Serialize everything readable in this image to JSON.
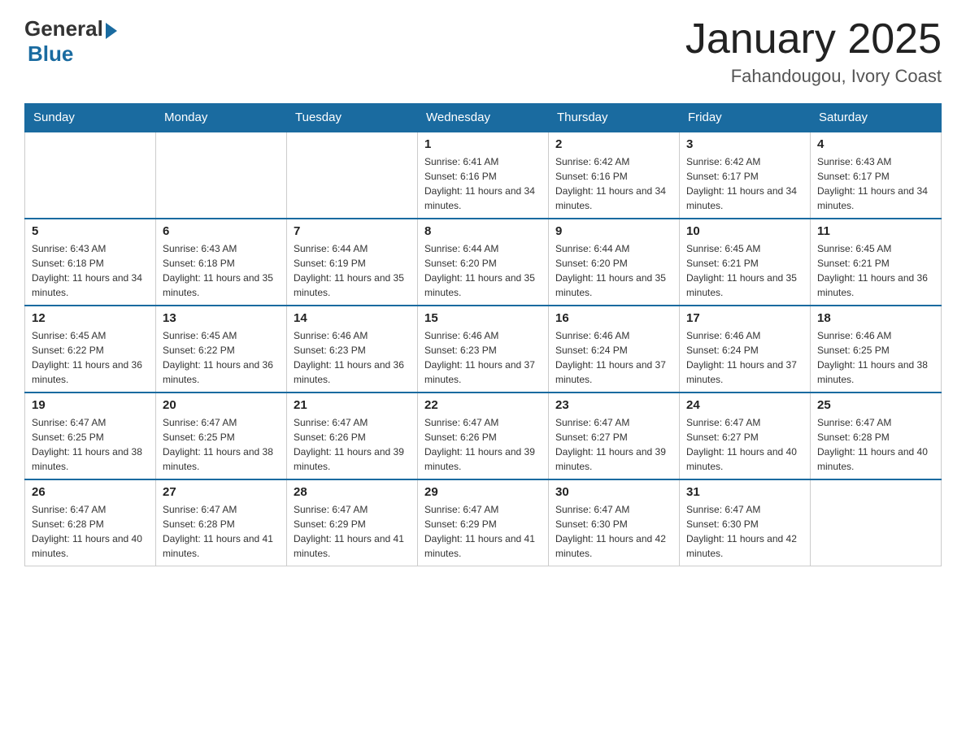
{
  "header": {
    "logo_general": "General",
    "logo_blue": "Blue",
    "month_title": "January 2025",
    "location": "Fahandougou, Ivory Coast"
  },
  "days_of_week": [
    "Sunday",
    "Monday",
    "Tuesday",
    "Wednesday",
    "Thursday",
    "Friday",
    "Saturday"
  ],
  "weeks": [
    {
      "days": [
        {
          "number": "",
          "sunrise": "",
          "sunset": "",
          "daylight": ""
        },
        {
          "number": "",
          "sunrise": "",
          "sunset": "",
          "daylight": ""
        },
        {
          "number": "",
          "sunrise": "",
          "sunset": "",
          "daylight": ""
        },
        {
          "number": "1",
          "sunrise": "Sunrise: 6:41 AM",
          "sunset": "Sunset: 6:16 PM",
          "daylight": "Daylight: 11 hours and 34 minutes."
        },
        {
          "number": "2",
          "sunrise": "Sunrise: 6:42 AM",
          "sunset": "Sunset: 6:16 PM",
          "daylight": "Daylight: 11 hours and 34 minutes."
        },
        {
          "number": "3",
          "sunrise": "Sunrise: 6:42 AM",
          "sunset": "Sunset: 6:17 PM",
          "daylight": "Daylight: 11 hours and 34 minutes."
        },
        {
          "number": "4",
          "sunrise": "Sunrise: 6:43 AM",
          "sunset": "Sunset: 6:17 PM",
          "daylight": "Daylight: 11 hours and 34 minutes."
        }
      ]
    },
    {
      "days": [
        {
          "number": "5",
          "sunrise": "Sunrise: 6:43 AM",
          "sunset": "Sunset: 6:18 PM",
          "daylight": "Daylight: 11 hours and 34 minutes."
        },
        {
          "number": "6",
          "sunrise": "Sunrise: 6:43 AM",
          "sunset": "Sunset: 6:18 PM",
          "daylight": "Daylight: 11 hours and 35 minutes."
        },
        {
          "number": "7",
          "sunrise": "Sunrise: 6:44 AM",
          "sunset": "Sunset: 6:19 PM",
          "daylight": "Daylight: 11 hours and 35 minutes."
        },
        {
          "number": "8",
          "sunrise": "Sunrise: 6:44 AM",
          "sunset": "Sunset: 6:20 PM",
          "daylight": "Daylight: 11 hours and 35 minutes."
        },
        {
          "number": "9",
          "sunrise": "Sunrise: 6:44 AM",
          "sunset": "Sunset: 6:20 PM",
          "daylight": "Daylight: 11 hours and 35 minutes."
        },
        {
          "number": "10",
          "sunrise": "Sunrise: 6:45 AM",
          "sunset": "Sunset: 6:21 PM",
          "daylight": "Daylight: 11 hours and 35 minutes."
        },
        {
          "number": "11",
          "sunrise": "Sunrise: 6:45 AM",
          "sunset": "Sunset: 6:21 PM",
          "daylight": "Daylight: 11 hours and 36 minutes."
        }
      ]
    },
    {
      "days": [
        {
          "number": "12",
          "sunrise": "Sunrise: 6:45 AM",
          "sunset": "Sunset: 6:22 PM",
          "daylight": "Daylight: 11 hours and 36 minutes."
        },
        {
          "number": "13",
          "sunrise": "Sunrise: 6:45 AM",
          "sunset": "Sunset: 6:22 PM",
          "daylight": "Daylight: 11 hours and 36 minutes."
        },
        {
          "number": "14",
          "sunrise": "Sunrise: 6:46 AM",
          "sunset": "Sunset: 6:23 PM",
          "daylight": "Daylight: 11 hours and 36 minutes."
        },
        {
          "number": "15",
          "sunrise": "Sunrise: 6:46 AM",
          "sunset": "Sunset: 6:23 PM",
          "daylight": "Daylight: 11 hours and 37 minutes."
        },
        {
          "number": "16",
          "sunrise": "Sunrise: 6:46 AM",
          "sunset": "Sunset: 6:24 PM",
          "daylight": "Daylight: 11 hours and 37 minutes."
        },
        {
          "number": "17",
          "sunrise": "Sunrise: 6:46 AM",
          "sunset": "Sunset: 6:24 PM",
          "daylight": "Daylight: 11 hours and 37 minutes."
        },
        {
          "number": "18",
          "sunrise": "Sunrise: 6:46 AM",
          "sunset": "Sunset: 6:25 PM",
          "daylight": "Daylight: 11 hours and 38 minutes."
        }
      ]
    },
    {
      "days": [
        {
          "number": "19",
          "sunrise": "Sunrise: 6:47 AM",
          "sunset": "Sunset: 6:25 PM",
          "daylight": "Daylight: 11 hours and 38 minutes."
        },
        {
          "number": "20",
          "sunrise": "Sunrise: 6:47 AM",
          "sunset": "Sunset: 6:25 PM",
          "daylight": "Daylight: 11 hours and 38 minutes."
        },
        {
          "number": "21",
          "sunrise": "Sunrise: 6:47 AM",
          "sunset": "Sunset: 6:26 PM",
          "daylight": "Daylight: 11 hours and 39 minutes."
        },
        {
          "number": "22",
          "sunrise": "Sunrise: 6:47 AM",
          "sunset": "Sunset: 6:26 PM",
          "daylight": "Daylight: 11 hours and 39 minutes."
        },
        {
          "number": "23",
          "sunrise": "Sunrise: 6:47 AM",
          "sunset": "Sunset: 6:27 PM",
          "daylight": "Daylight: 11 hours and 39 minutes."
        },
        {
          "number": "24",
          "sunrise": "Sunrise: 6:47 AM",
          "sunset": "Sunset: 6:27 PM",
          "daylight": "Daylight: 11 hours and 40 minutes."
        },
        {
          "number": "25",
          "sunrise": "Sunrise: 6:47 AM",
          "sunset": "Sunset: 6:28 PM",
          "daylight": "Daylight: 11 hours and 40 minutes."
        }
      ]
    },
    {
      "days": [
        {
          "number": "26",
          "sunrise": "Sunrise: 6:47 AM",
          "sunset": "Sunset: 6:28 PM",
          "daylight": "Daylight: 11 hours and 40 minutes."
        },
        {
          "number": "27",
          "sunrise": "Sunrise: 6:47 AM",
          "sunset": "Sunset: 6:28 PM",
          "daylight": "Daylight: 11 hours and 41 minutes."
        },
        {
          "number": "28",
          "sunrise": "Sunrise: 6:47 AM",
          "sunset": "Sunset: 6:29 PM",
          "daylight": "Daylight: 11 hours and 41 minutes."
        },
        {
          "number": "29",
          "sunrise": "Sunrise: 6:47 AM",
          "sunset": "Sunset: 6:29 PM",
          "daylight": "Daylight: 11 hours and 41 minutes."
        },
        {
          "number": "30",
          "sunrise": "Sunrise: 6:47 AM",
          "sunset": "Sunset: 6:30 PM",
          "daylight": "Daylight: 11 hours and 42 minutes."
        },
        {
          "number": "31",
          "sunrise": "Sunrise: 6:47 AM",
          "sunset": "Sunset: 6:30 PM",
          "daylight": "Daylight: 11 hours and 42 minutes."
        },
        {
          "number": "",
          "sunrise": "",
          "sunset": "",
          "daylight": ""
        }
      ]
    }
  ]
}
